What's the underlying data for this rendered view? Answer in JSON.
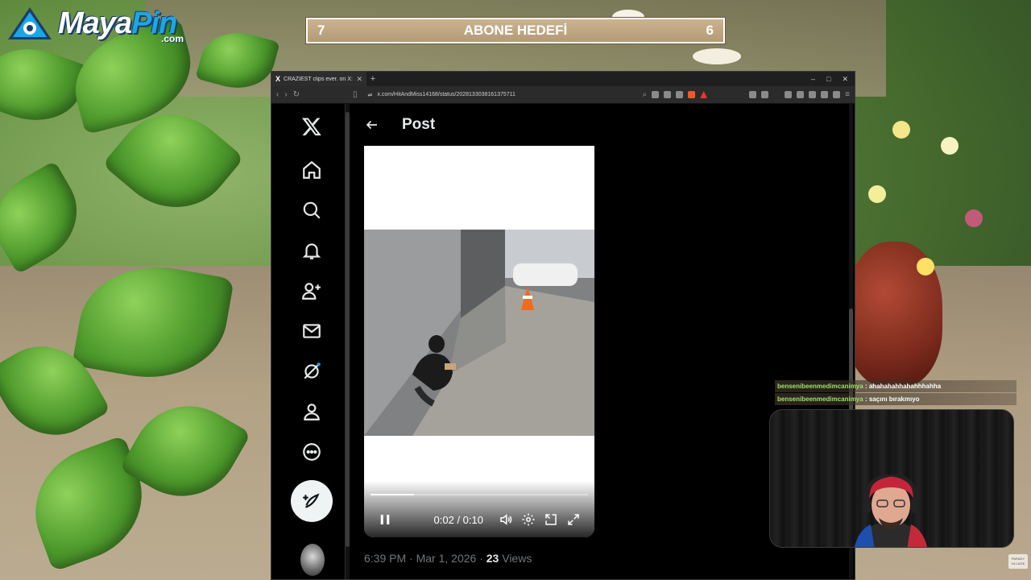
{
  "brand": {
    "logo_main": "Maya",
    "logo_accent": "Pin",
    "logo_suffix": ".com"
  },
  "goal": {
    "left_value": "7",
    "title": "ABONE HEDEFİ",
    "right_value": "6"
  },
  "browser": {
    "tab_title": "CRAZIEST clips ever. on X: \"0",
    "tab_favicon": "X",
    "new_tab": "+",
    "url": "x.com/HitAndMiss14168/status/2028133038161375711",
    "window_controls": [
      "–",
      "□",
      "✕"
    ]
  },
  "x": {
    "logo_icon": "x-logo-icon",
    "nav_icons": [
      "home-icon",
      "search-icon",
      "bell-icon",
      "follow-icon",
      "mail-icon",
      "grok-icon",
      "profile-icon",
      "more-icon"
    ],
    "header": {
      "back_icon": "back-arrow-icon",
      "title": "Post"
    },
    "video": {
      "time": "0:02 / 0:10",
      "progress": 0.2,
      "playing": true
    },
    "meta": {
      "time": "6:39 PM",
      "sep1": "·",
      "date": "Mar 1, 2026",
      "sep2": "·",
      "views_count": "23",
      "views_label": "Views"
    }
  },
  "chat": [
    {
      "user": "bensenibeenmedimcanimya",
      "sep": ":",
      "message": "ahahahahhahahhhahha"
    },
    {
      "user": "bensenibeenmedimcanimya",
      "sep": ":",
      "message": "saçını bırakmıyo"
    }
  ],
  "corner_logo": "PARADY VILLAGE",
  "colors": {
    "x_text": "#e7e9ea",
    "x_muted": "#71767b",
    "x_accent": "#1d9bf0",
    "goal_bg": "#b49b76",
    "chat_user": "#9ee46a"
  }
}
